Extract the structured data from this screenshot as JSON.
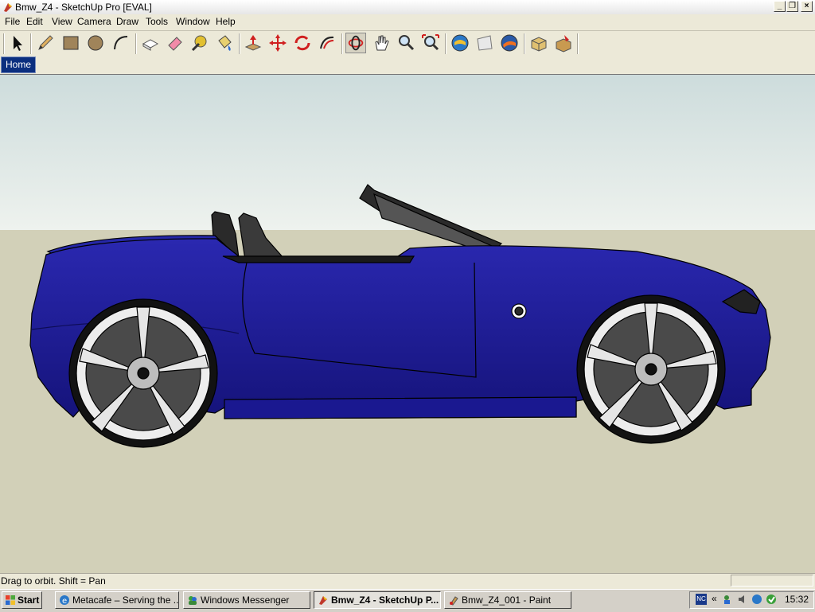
{
  "window": {
    "title": "Bmw_Z4 - SketchUp Pro [EVAL]",
    "controls": [
      "minimize",
      "restore",
      "close"
    ]
  },
  "menu": [
    "File",
    "Edit",
    "View",
    "Camera",
    "Draw",
    "Tools",
    "Window",
    "Help"
  ],
  "toolbar_icons": [
    "select-icon",
    "pencil-icon",
    "rectangle-icon",
    "circle-icon",
    "arc-icon",
    "make-component-icon",
    "eraser-icon",
    "tape-measure-icon",
    "paint-bucket-icon",
    "push-pull-icon",
    "move-icon",
    "rotate-icon",
    "follow-me-icon",
    "orbit-icon",
    "pan-icon",
    "zoom-icon",
    "zoom-extents-icon",
    "get-models-icon",
    "share-model-icon",
    "google-earth-icon",
    "components-icon",
    "materials-icon"
  ],
  "scene_tabs": [
    {
      "label": "Home",
      "active": true
    }
  ],
  "colors": {
    "sky_top": "#cddcdc",
    "sky_bottom": "#eef2ee",
    "ground": "#d2d0b8",
    "car_body": "#1c1a96",
    "tab_active": "#0b2f7f"
  },
  "status": {
    "text": "Drag to orbit.  Shift = Pan"
  },
  "taskbar": {
    "start_label": "Start",
    "tasks": [
      {
        "label": "Metacafe – Serving the ...",
        "icon": "ie-icon",
        "active": false
      },
      {
        "label": "Windows Messenger",
        "icon": "messenger-icon",
        "active": false
      },
      {
        "label": "Bmw_Z4 - SketchUp P...",
        "icon": "sketchup-icon",
        "active": true
      },
      {
        "label": "Bmw_Z4_001 - Paint",
        "icon": "paint-icon",
        "active": false
      }
    ],
    "clock": "15:32",
    "tray_icons": [
      "nc-icon",
      "network-icon",
      "sound-icon",
      "messenger-tray-icon",
      "antivirus-icon"
    ]
  }
}
